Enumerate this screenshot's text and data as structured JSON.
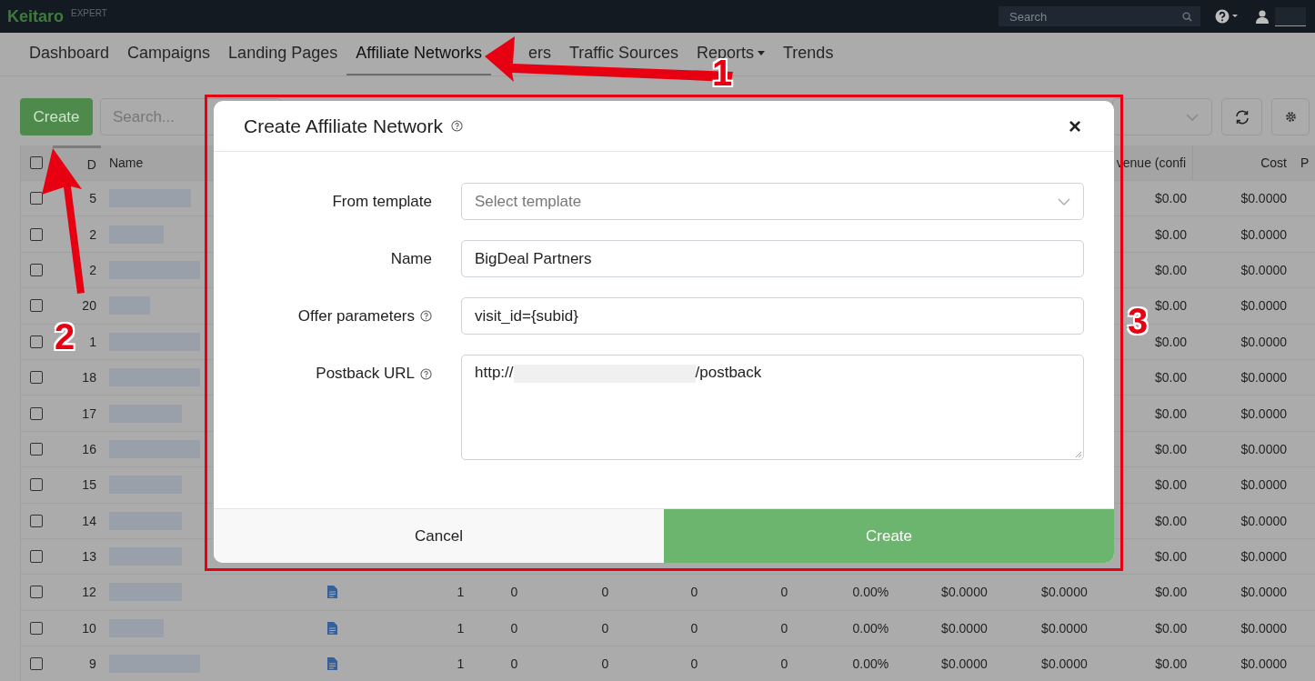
{
  "topbar": {
    "logo": "Keitaro",
    "edition": "EXPERT",
    "search": {
      "placeholder": "Search"
    }
  },
  "nav": [
    {
      "label": "Dashboard",
      "selected": false,
      "dropdown": false
    },
    {
      "label": "Campaigns",
      "selected": false,
      "dropdown": false
    },
    {
      "label": "Landing Pages",
      "selected": false,
      "dropdown": false
    },
    {
      "label": "Affiliate Networks",
      "selected": true,
      "dropdown": false
    },
    {
      "label": "ers",
      "selected": false,
      "dropdown": false
    },
    {
      "label": "Traffic Sources",
      "selected": false,
      "dropdown": false
    },
    {
      "label": "Reports",
      "selected": false,
      "dropdown": true
    },
    {
      "label": "Trends",
      "selected": false,
      "dropdown": false
    }
  ],
  "toolbar": {
    "create": "Create",
    "search": {
      "placeholder": "Search..."
    }
  },
  "table": {
    "all_checked": false,
    "columns": [
      "D",
      "Name",
      "venue (confi",
      "Cost",
      "P"
    ],
    "rows": [
      {
        "id": "5",
        "checked": false,
        "revenue": "$0.00",
        "cost": "$0.0000"
      },
      {
        "id": "2",
        "checked": false,
        "revenue": "$0.00",
        "cost": "$0.0000"
      },
      {
        "id": "2",
        "checked": false,
        "revenue": "$0.00",
        "cost": "$0.0000"
      },
      {
        "id": "20",
        "checked": false,
        "revenue": "$0.00",
        "cost": "$0.0000"
      },
      {
        "id": "1",
        "checked": false,
        "revenue": "$0.00",
        "cost": "$0.0000"
      },
      {
        "id": "18",
        "checked": false,
        "revenue": "$0.00",
        "cost": "$0.0000"
      },
      {
        "id": "17",
        "checked": false,
        "revenue": "$0.00",
        "cost": "$0.0000"
      },
      {
        "id": "16",
        "checked": false,
        "revenue": "$0.00",
        "cost": "$0.0000"
      },
      {
        "id": "15",
        "checked": false,
        "revenue": "$0.00",
        "cost": "$0.0000"
      },
      {
        "id": "14",
        "checked": false,
        "revenue": "$0.00",
        "cost": "$0.0000"
      },
      {
        "id": "13",
        "checked": false,
        "revenue": "$0.00",
        "cost": "$0.0000"
      },
      {
        "id": "12",
        "checked": false,
        "cells": [
          "1",
          "0",
          "0",
          "0",
          "0",
          "0.00%",
          "$0.0000",
          "$0.0000"
        ],
        "revenue": "$0.00",
        "cost": "$0.0000"
      },
      {
        "id": "10",
        "checked": false,
        "cells": [
          "1",
          "0",
          "0",
          "0",
          "0",
          "0.00%",
          "$0.0000",
          "$0.0000"
        ],
        "revenue": "$0.00",
        "cost": "$0.0000"
      },
      {
        "id": "9",
        "checked": false,
        "cells": [
          "1",
          "0",
          "0",
          "0",
          "0",
          "0.00%",
          "$0.0000",
          "$0.0000"
        ],
        "revenue": "$0.00",
        "cost": "$0.0000"
      }
    ]
  },
  "modal": {
    "title": "Create Affiliate Network",
    "close": "×",
    "fields": [
      {
        "kind": "select",
        "label": "From template",
        "help": false,
        "placeholder": "Select template"
      },
      {
        "kind": "text",
        "label": "Name",
        "help": false,
        "value": "BigDeal Partners"
      },
      {
        "kind": "text",
        "label": "Offer parameters",
        "help": true,
        "value": "visit_id={subid}"
      },
      {
        "kind": "textarea",
        "label": "Postback URL",
        "help": true,
        "value_start": "http://",
        "value_end": "/postback"
      }
    ],
    "cancel": "Cancel",
    "submit": "Create"
  },
  "annotations": [
    "1",
    "2",
    "3"
  ]
}
